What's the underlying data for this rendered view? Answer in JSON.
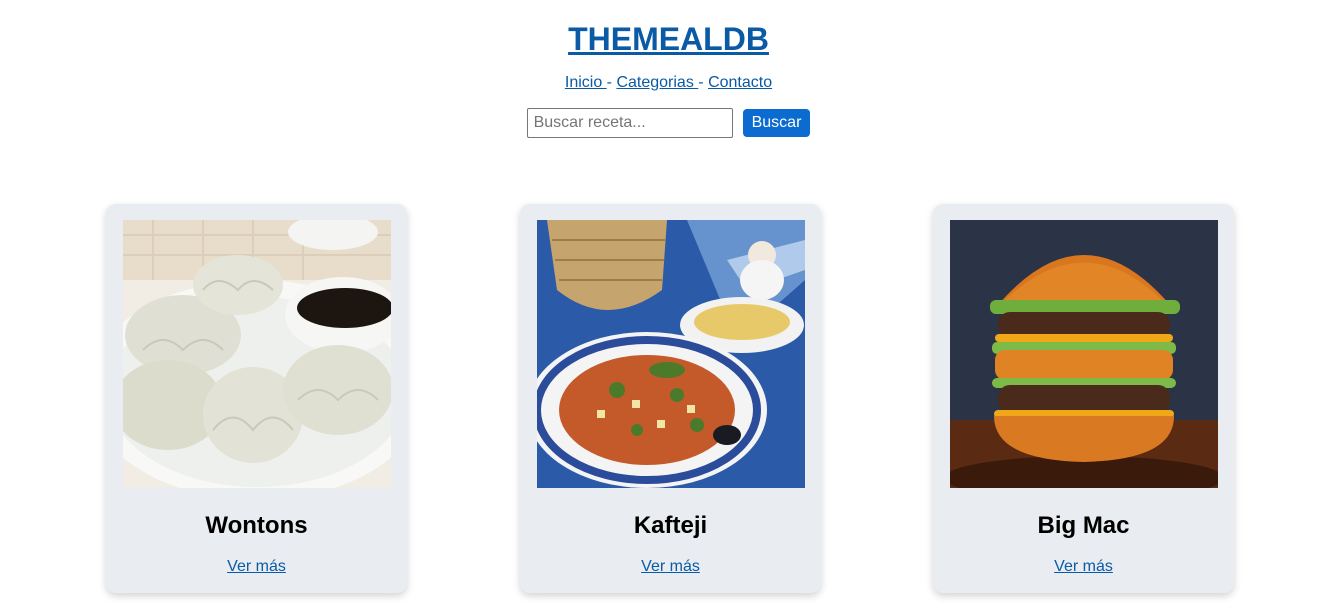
{
  "site": {
    "title": "THEMEALDB"
  },
  "nav": {
    "items": [
      {
        "label": "Inicio "
      },
      {
        "label": "Categorias "
      },
      {
        "label": "Contacto"
      }
    ],
    "separator": "-"
  },
  "search": {
    "placeholder": "Buscar receta...",
    "value": "",
    "button_label": "Buscar"
  },
  "meals": [
    {
      "name": "Wontons",
      "link_label": "Ver más",
      "image": "wontons-photo"
    },
    {
      "name": "Kafteji",
      "link_label": "Ver más",
      "image": "kafteji-photo"
    },
    {
      "name": "Big Mac",
      "link_label": "Ver más",
      "image": "big-mac-photo"
    }
  ],
  "colors": {
    "link": "#0a5aa5",
    "button": "#0b6bd1",
    "card_bg": "#e9ecf0"
  }
}
